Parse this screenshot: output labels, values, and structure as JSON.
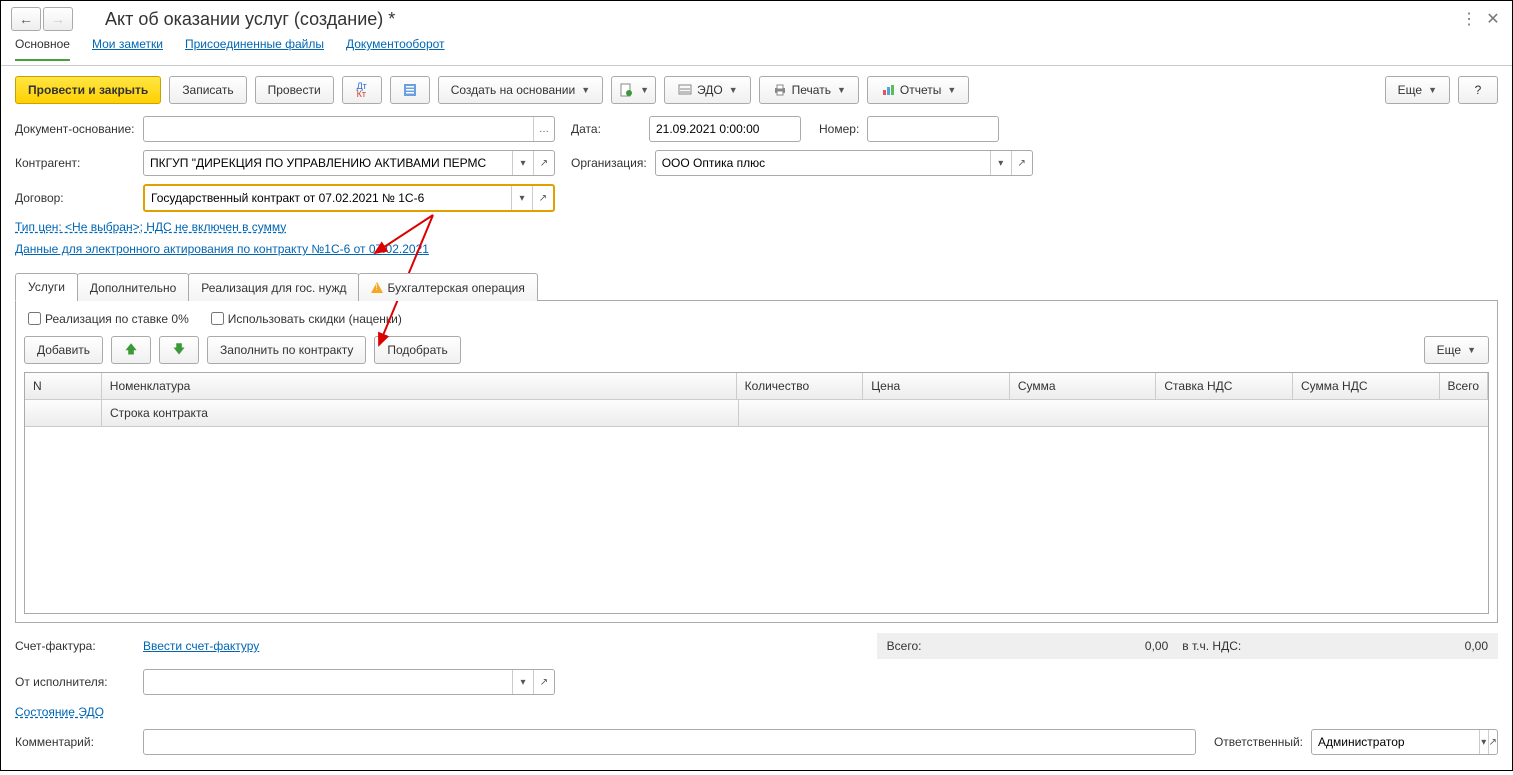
{
  "header": {
    "title": "Акт об оказании услуг (создание) *"
  },
  "subnav": {
    "main": "Основное",
    "notes": "Мои заметки",
    "files": "Присоединенные файлы",
    "docflow": "Документооборот"
  },
  "toolbar": {
    "post_close": "Провести и закрыть",
    "save": "Записать",
    "post": "Провести",
    "create_based": "Создать на основании",
    "edo": "ЭДО",
    "print": "Печать",
    "reports": "Отчеты",
    "more": "Еще",
    "help": "?"
  },
  "form": {
    "doc_base_lbl": "Документ-основание:",
    "doc_base": "",
    "date_lbl": "Дата:",
    "date": "21.09.2021 0:00:00",
    "num_lbl": "Номер:",
    "num": "",
    "ca_lbl": "Контрагент:",
    "ca": "ПКГУП \"ДИРЕКЦИЯ ПО УПРАВЛЕНИЮ АКТИВАМИ ПЕРМС",
    "org_lbl": "Организация:",
    "org": "ООО Оптика плюс",
    "contract_lbl": "Договор:",
    "contract": "Государственный контракт от 07.02.2021 № 1С-6",
    "price_link": "Тип цен: <Не выбран>; НДС не включен в сумму",
    "act_link": "Данные для электронного актирования по контракту №1С-6 от 07.02.2021"
  },
  "tabs": {
    "services": "Услуги",
    "extra": "Дополнительно",
    "gos": "Реализация для гос. нужд",
    "buh": "Бухгалтерская операция"
  },
  "panel": {
    "cb1": "Реализация по ставке 0%",
    "cb2": "Использовать скидки (наценки)",
    "add": "Добавить",
    "fill": "Заполнить по контракту",
    "pick": "Подобрать",
    "more": "Еще"
  },
  "grid": {
    "c_n": "N",
    "c_nom": "Номенклатура",
    "c_qty": "Количество",
    "c_price": "Цена",
    "c_sum": "Сумма",
    "c_vatrate": "Ставка НДС",
    "c_vatsum": "Сумма НДС",
    "c_total": "Всего",
    "c_contract_line": "Строка контракта"
  },
  "footer": {
    "sf_lbl": "Счет-фактура:",
    "sf_link": "Ввести счет-фактуру",
    "total_lbl": "Всего:",
    "total": "0,00",
    "vat_lbl": "в т.ч. НДС:",
    "vat": "0,00",
    "from_lbl": "От исполнителя:",
    "edo_link": "Состояние ЭДО",
    "comment_lbl": "Комментарий:",
    "resp_lbl": "Ответственный:",
    "resp": "Администратор"
  }
}
